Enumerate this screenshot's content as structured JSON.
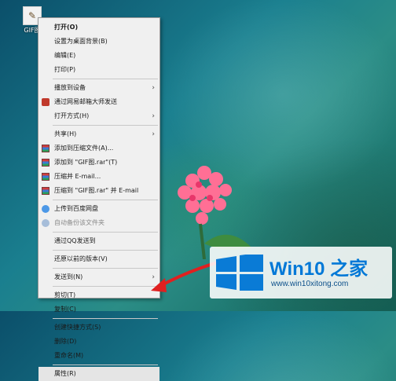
{
  "desktop": {
    "icon_label": "GIF图"
  },
  "context_menu": {
    "items": [
      {
        "label": "打开(O)",
        "bold": true
      },
      {
        "label": "设置为桌面背景(B)"
      },
      {
        "label": "编辑(E)"
      },
      {
        "label": "打印(P)"
      },
      {
        "label": "播放到设备",
        "submenu": true
      },
      {
        "label": "通过网易邮箱大师发送",
        "icon": "netease-mail-icon"
      },
      {
        "label": "打开方式(H)",
        "submenu": true
      },
      {
        "label": "共享(H)",
        "submenu": true
      },
      {
        "label": "添加到压缩文件(A)...",
        "icon": "winrar-icon"
      },
      {
        "label": "添加到 \"GIF图.rar\"(T)",
        "icon": "winrar-icon"
      },
      {
        "label": "压缩并 E-mail...",
        "icon": "winrar-icon"
      },
      {
        "label": "压缩到 \"GIF图.rar\" 并 E-mail",
        "icon": "winrar-icon"
      },
      {
        "label": "上传到百度网盘",
        "icon": "baidu-cloud-icon"
      },
      {
        "label": "自动备份该文件夹",
        "icon": "baidu-cloud-icon",
        "disabled": true
      },
      {
        "label": "通过QQ发送到"
      },
      {
        "label": "还原以前的版本(V)"
      },
      {
        "label": "发送到(N)",
        "submenu": true
      },
      {
        "label": "剪切(T)"
      },
      {
        "label": "复制(C)"
      },
      {
        "label": "创建快捷方式(S)"
      },
      {
        "label": "删除(D)"
      },
      {
        "label": "重命名(M)"
      },
      {
        "label": "属性(R)",
        "highlighted": true
      }
    ],
    "submenu_arrow": "›"
  },
  "watermark": {
    "brand": "Win10 之家",
    "url": "www.win10xitong.com"
  },
  "colors": {
    "accent": "#0078d7",
    "arrow": "#e02020"
  }
}
